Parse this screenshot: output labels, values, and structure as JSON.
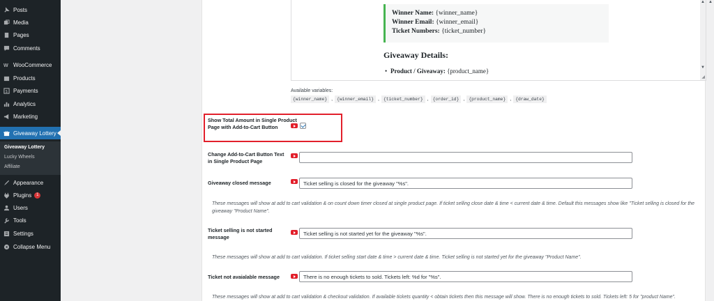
{
  "sidebar": {
    "items": [
      {
        "label": "Posts",
        "icon": "pin-icon"
      },
      {
        "label": "Media",
        "icon": "media-icon"
      },
      {
        "label": "Pages",
        "icon": "pages-icon"
      },
      {
        "label": "Comments",
        "icon": "comments-icon"
      },
      {
        "label": "WooCommerce",
        "icon": "woocommerce-icon"
      },
      {
        "label": "Products",
        "icon": "products-icon"
      },
      {
        "label": "Payments",
        "icon": "payments-icon"
      },
      {
        "label": "Analytics",
        "icon": "analytics-icon"
      },
      {
        "label": "Marketing",
        "icon": "marketing-icon"
      },
      {
        "label": "Giveaway Lottery",
        "icon": "giveaway-icon"
      },
      {
        "label": "Appearance",
        "icon": "appearance-icon"
      },
      {
        "label": "Plugins",
        "icon": "plugins-icon",
        "badge": "1"
      },
      {
        "label": "Users",
        "icon": "users-icon"
      },
      {
        "label": "Tools",
        "icon": "tools-icon"
      },
      {
        "label": "Settings",
        "icon": "settings-icon"
      },
      {
        "label": "Collapse Menu",
        "icon": "collapse-icon"
      }
    ],
    "submenu": [
      "Giveaway Lottery",
      "Lucky Wheels",
      "Affiliate"
    ]
  },
  "editor": {
    "winner_name_label": "Winner Name:",
    "winner_name_var": "{winner_name}",
    "winner_email_label": "Winner Email:",
    "winner_email_var": "{winner_email}",
    "ticket_numbers_label": "Ticket Numbers:",
    "ticket_numbers_var": "{ticket_number}",
    "details_heading": "Giveaway Details:",
    "product_label": "Product / Giveaway:",
    "product_var": "{product_name}"
  },
  "variables": {
    "label": "Available variables:",
    "items": [
      "{winner_name}",
      "{winner_email}",
      "{ticket_number}",
      "{order_id}",
      "{product_name}",
      "{draw_date}"
    ],
    "separator": ","
  },
  "settings": {
    "show_total": {
      "label": "Show Total Amount in Single Product Page with Add-to-Cart Button",
      "checked": true
    },
    "change_button_text": {
      "label": "Change Add-to-Cart Button Text in Single Product Page",
      "value": ""
    },
    "closed_message": {
      "label": "Giveaway closed message",
      "value": "Ticket selling is closed for the giveaway \"%s\".",
      "description": "These messages will show at add to cart validation & on count down timer closed at single product page. If ticket selling close date & time < current date & time. Default this messages show like \"Ticket selling is closed for the giveaway \"Product Name\"."
    },
    "not_started_message": {
      "label": "Ticket selling is not started message",
      "value": "Ticket selling is not started yet for the giveaway \"%s\".",
      "description": "These messages will show at add to cart validation. If ticket selling start date & time > current date & time. Ticket selling is not started yet for the giveaway \"Product Name\"."
    },
    "not_available_message": {
      "label": "Ticket not avaialable message",
      "value": "There is no enough tickets to sold. Tickets left: %d for \"%s\".",
      "description": "These messages will show at add to cart validation & checkout validation. If available tickets quantity < obtain tickets then this message will show. There is no enough tickets to sold. Tickets left: 5 for \"product Name\"."
    }
  },
  "colors": {
    "sidebar_bg": "#1d2327",
    "accent": "#2271b1",
    "highlight": "#e21f2b",
    "quote_border": "#46b450"
  }
}
